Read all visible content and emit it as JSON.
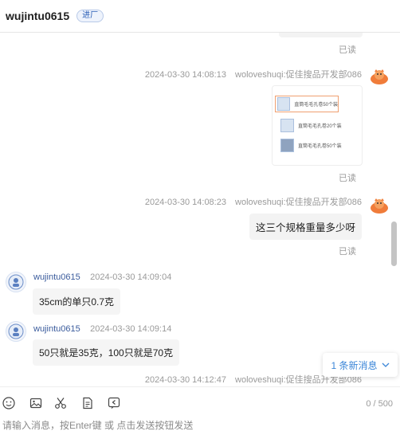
{
  "header": {
    "name": "wujintu0615",
    "tag": "进厂"
  },
  "messages": {
    "read_label": "已读",
    "m1": {
      "time": "2024-03-30 14:08:13",
      "sender": "woloveshuqi:促佳搜品开发部086"
    },
    "m1_products": [
      {
        "title": "直筒毛毛孔卷50个装"
      },
      {
        "title": "直筒毛毛孔卷20个装"
      },
      {
        "title": "直筒毛毛孔卷50个装"
      }
    ],
    "m2": {
      "time": "2024-03-30 14:08:23",
      "sender": "woloveshuqi:促佳搜品开发部086",
      "text": "这三个规格重量多少呀"
    },
    "m3": {
      "sender": "wujintu0615",
      "time": "2024-03-30 14:09:04",
      "text": "35cm的单只0.7克"
    },
    "m4": {
      "sender": "wujintu0615",
      "time": "2024-03-30 14:09:14",
      "text": "50只就是35克，100只就是70克"
    },
    "m5": {
      "time": "2024-03-30 14:12:47",
      "sender": "woloveshuqi:促佳搜品开发部086"
    }
  },
  "new_messages": {
    "label": "1 条新消息"
  },
  "toolbar": {
    "counter": "0 / 500"
  },
  "input": {
    "placeholder": "请输入消息，按Enter键 或 点击发送按钮发送"
  }
}
